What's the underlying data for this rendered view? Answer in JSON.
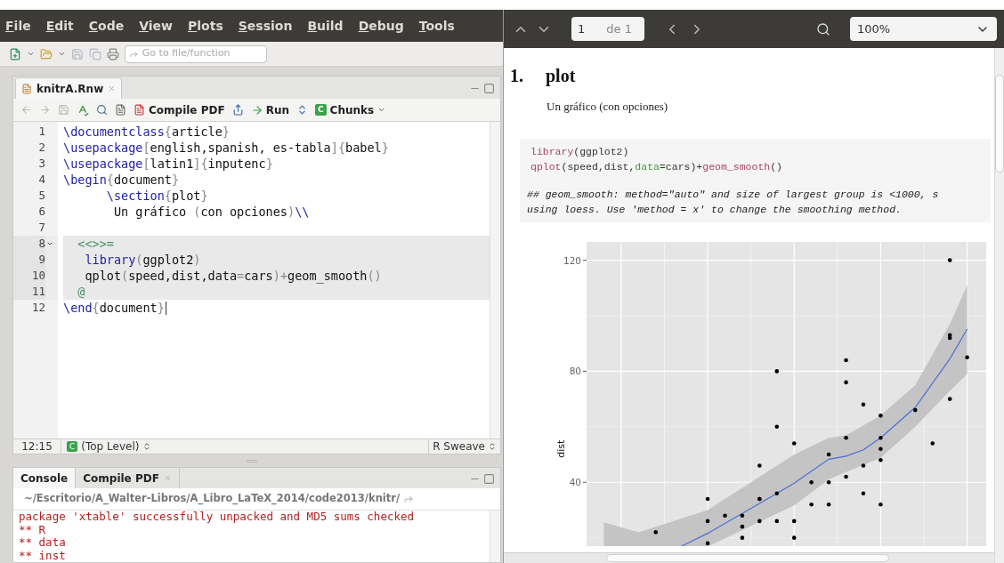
{
  "menu": [
    {
      "label": "File"
    },
    {
      "label": "Edit"
    },
    {
      "label": "Code"
    },
    {
      "label": "View"
    },
    {
      "label": "Plots"
    },
    {
      "label": "Session"
    },
    {
      "label": "Build"
    },
    {
      "label": "Debug"
    },
    {
      "label": "Tools"
    }
  ],
  "toolbar": {
    "goto_placeholder": "Go to file/function"
  },
  "editor": {
    "tab": {
      "label": "knitrA.Rnw",
      "selected": true
    },
    "actions": {
      "compile": "Compile PDF",
      "run": "Run",
      "chunks_badge": "C",
      "chunks": "Chunks"
    },
    "lines": [
      {
        "number": "1",
        "chunk": false,
        "fold": false,
        "cursor": false,
        "tokens": [
          {
            "kind": "cmd",
            "text": "\\documentclass"
          },
          {
            "kind": "brace",
            "text": "{"
          },
          {
            "kind": "text",
            "text": "article"
          },
          {
            "kind": "brace",
            "text": "}"
          }
        ]
      },
      {
        "number": "2",
        "chunk": false,
        "fold": false,
        "cursor": false,
        "tokens": [
          {
            "kind": "cmd",
            "text": "\\usepackage"
          },
          {
            "kind": "brace",
            "text": "["
          },
          {
            "kind": "text",
            "text": "english,spanish, es-tabla"
          },
          {
            "kind": "brace",
            "text": "]{"
          },
          {
            "kind": "text",
            "text": "babel"
          },
          {
            "kind": "brace",
            "text": "}"
          }
        ]
      },
      {
        "number": "3",
        "chunk": false,
        "fold": false,
        "cursor": false,
        "tokens": [
          {
            "kind": "cmd",
            "text": "\\usepackage"
          },
          {
            "kind": "brace",
            "text": "["
          },
          {
            "kind": "text",
            "text": "latin1"
          },
          {
            "kind": "brace",
            "text": "]{"
          },
          {
            "kind": "text",
            "text": "inputenc"
          },
          {
            "kind": "brace",
            "text": "}"
          }
        ]
      },
      {
        "number": "4",
        "chunk": false,
        "fold": false,
        "cursor": false,
        "tokens": [
          {
            "kind": "cmd",
            "text": "\\begin"
          },
          {
            "kind": "brace",
            "text": "{"
          },
          {
            "kind": "text",
            "text": "document"
          },
          {
            "kind": "brace",
            "text": "}"
          }
        ]
      },
      {
        "number": "5",
        "chunk": false,
        "fold": false,
        "cursor": false,
        "tokens": [
          {
            "kind": "cmd",
            "text": "      \\section"
          },
          {
            "kind": "brace",
            "text": "{"
          },
          {
            "kind": "text",
            "text": "plot"
          },
          {
            "kind": "brace",
            "text": "}"
          }
        ]
      },
      {
        "number": "6",
        "chunk": false,
        "fold": false,
        "cursor": false,
        "tokens": [
          {
            "kind": "text",
            "text": "       Un gráfico "
          },
          {
            "kind": "brace",
            "text": "("
          },
          {
            "kind": "text",
            "text": "con opciones"
          },
          {
            "kind": "brace",
            "text": ")"
          },
          {
            "kind": "cmd",
            "text": "\\\\"
          }
        ]
      },
      {
        "number": "7",
        "chunk": false,
        "fold": false,
        "cursor": false
      },
      {
        "number": "8",
        "chunk": true,
        "fold": true,
        "cursor": false,
        "tokens": [
          {
            "kind": "chunk",
            "text": "  <<>>="
          }
        ]
      },
      {
        "number": "9",
        "chunk": true,
        "fold": false,
        "cursor": false,
        "tokens": [
          {
            "kind": "cmd",
            "text": "   library"
          },
          {
            "kind": "brace",
            "text": "("
          },
          {
            "kind": "text",
            "text": "ggplot2"
          },
          {
            "kind": "brace",
            "text": ")"
          }
        ]
      },
      {
        "number": "10",
        "chunk": true,
        "fold": false,
        "cursor": false,
        "tokens": [
          {
            "kind": "text",
            "text": "   qplot"
          },
          {
            "kind": "brace",
            "text": "("
          },
          {
            "kind": "text",
            "text": "speed,dist,data"
          },
          {
            "kind": "brace",
            "text": "="
          },
          {
            "kind": "text",
            "text": "cars"
          },
          {
            "kind": "brace",
            "text": ")+"
          },
          {
            "kind": "text",
            "text": "geom_smooth"
          },
          {
            "kind": "brace",
            "text": "()"
          }
        ]
      },
      {
        "number": "11",
        "chunk": true,
        "fold": false,
        "cursor": false,
        "tokens": [
          {
            "kind": "chunk",
            "text": "  @"
          }
        ]
      },
      {
        "number": "12",
        "chunk": false,
        "fold": false,
        "cursor": true,
        "tokens": [
          {
            "kind": "cmd",
            "text": "\\end"
          },
          {
            "kind": "brace",
            "text": "{"
          },
          {
            "kind": "text",
            "text": "document"
          },
          {
            "kind": "brace",
            "text": "}"
          }
        ]
      }
    ],
    "status": {
      "position": "12:15",
      "badge": "C",
      "scope": "(Top Level)",
      "mode": "R Sweave"
    }
  },
  "console": {
    "tabs": [
      {
        "label": "Console",
        "selected": true,
        "closable": false
      },
      {
        "label": "Compile PDF",
        "selected": false,
        "closable": true
      }
    ],
    "path": "~/Escritorio/A_Walter-Libros/A_Libro_LaTeX_2014/code2013/knitr/",
    "output": [
      "package 'xtable' successfully unpacked and MD5 sums checked",
      "** R",
      "** data",
      "** inst"
    ]
  },
  "viewer": {
    "page": "1",
    "page_count": "de 1",
    "zoom": "100%",
    "heading_number": "1.",
    "heading": "plot",
    "paragraph": "Un gráfico (con opciones)",
    "code": [
      [
        {
          "kind": "fn",
          "text": "library"
        },
        {
          "kind": "plain",
          "text": "(ggplot2)"
        }
      ],
      [
        {
          "kind": "fn",
          "text": "qplot"
        },
        {
          "kind": "plain",
          "text": "(speed,dist,"
        },
        {
          "kind": "arg",
          "text": "data"
        },
        {
          "kind": "plain",
          "text": "=cars)+"
        },
        {
          "kind": "fn",
          "text": "geom_smooth"
        },
        {
          "kind": "plain",
          "text": "()"
        }
      ]
    ],
    "output": [
      "## geom_smooth: method=\"auto\" and size of largest group is <1000, s",
      "using loess. Use 'method = x' to change the smoothing method."
    ],
    "plot": {
      "y_axis_label": "dist",
      "y_tick_labels": [
        "120",
        "80",
        "40"
      ]
    }
  }
}
